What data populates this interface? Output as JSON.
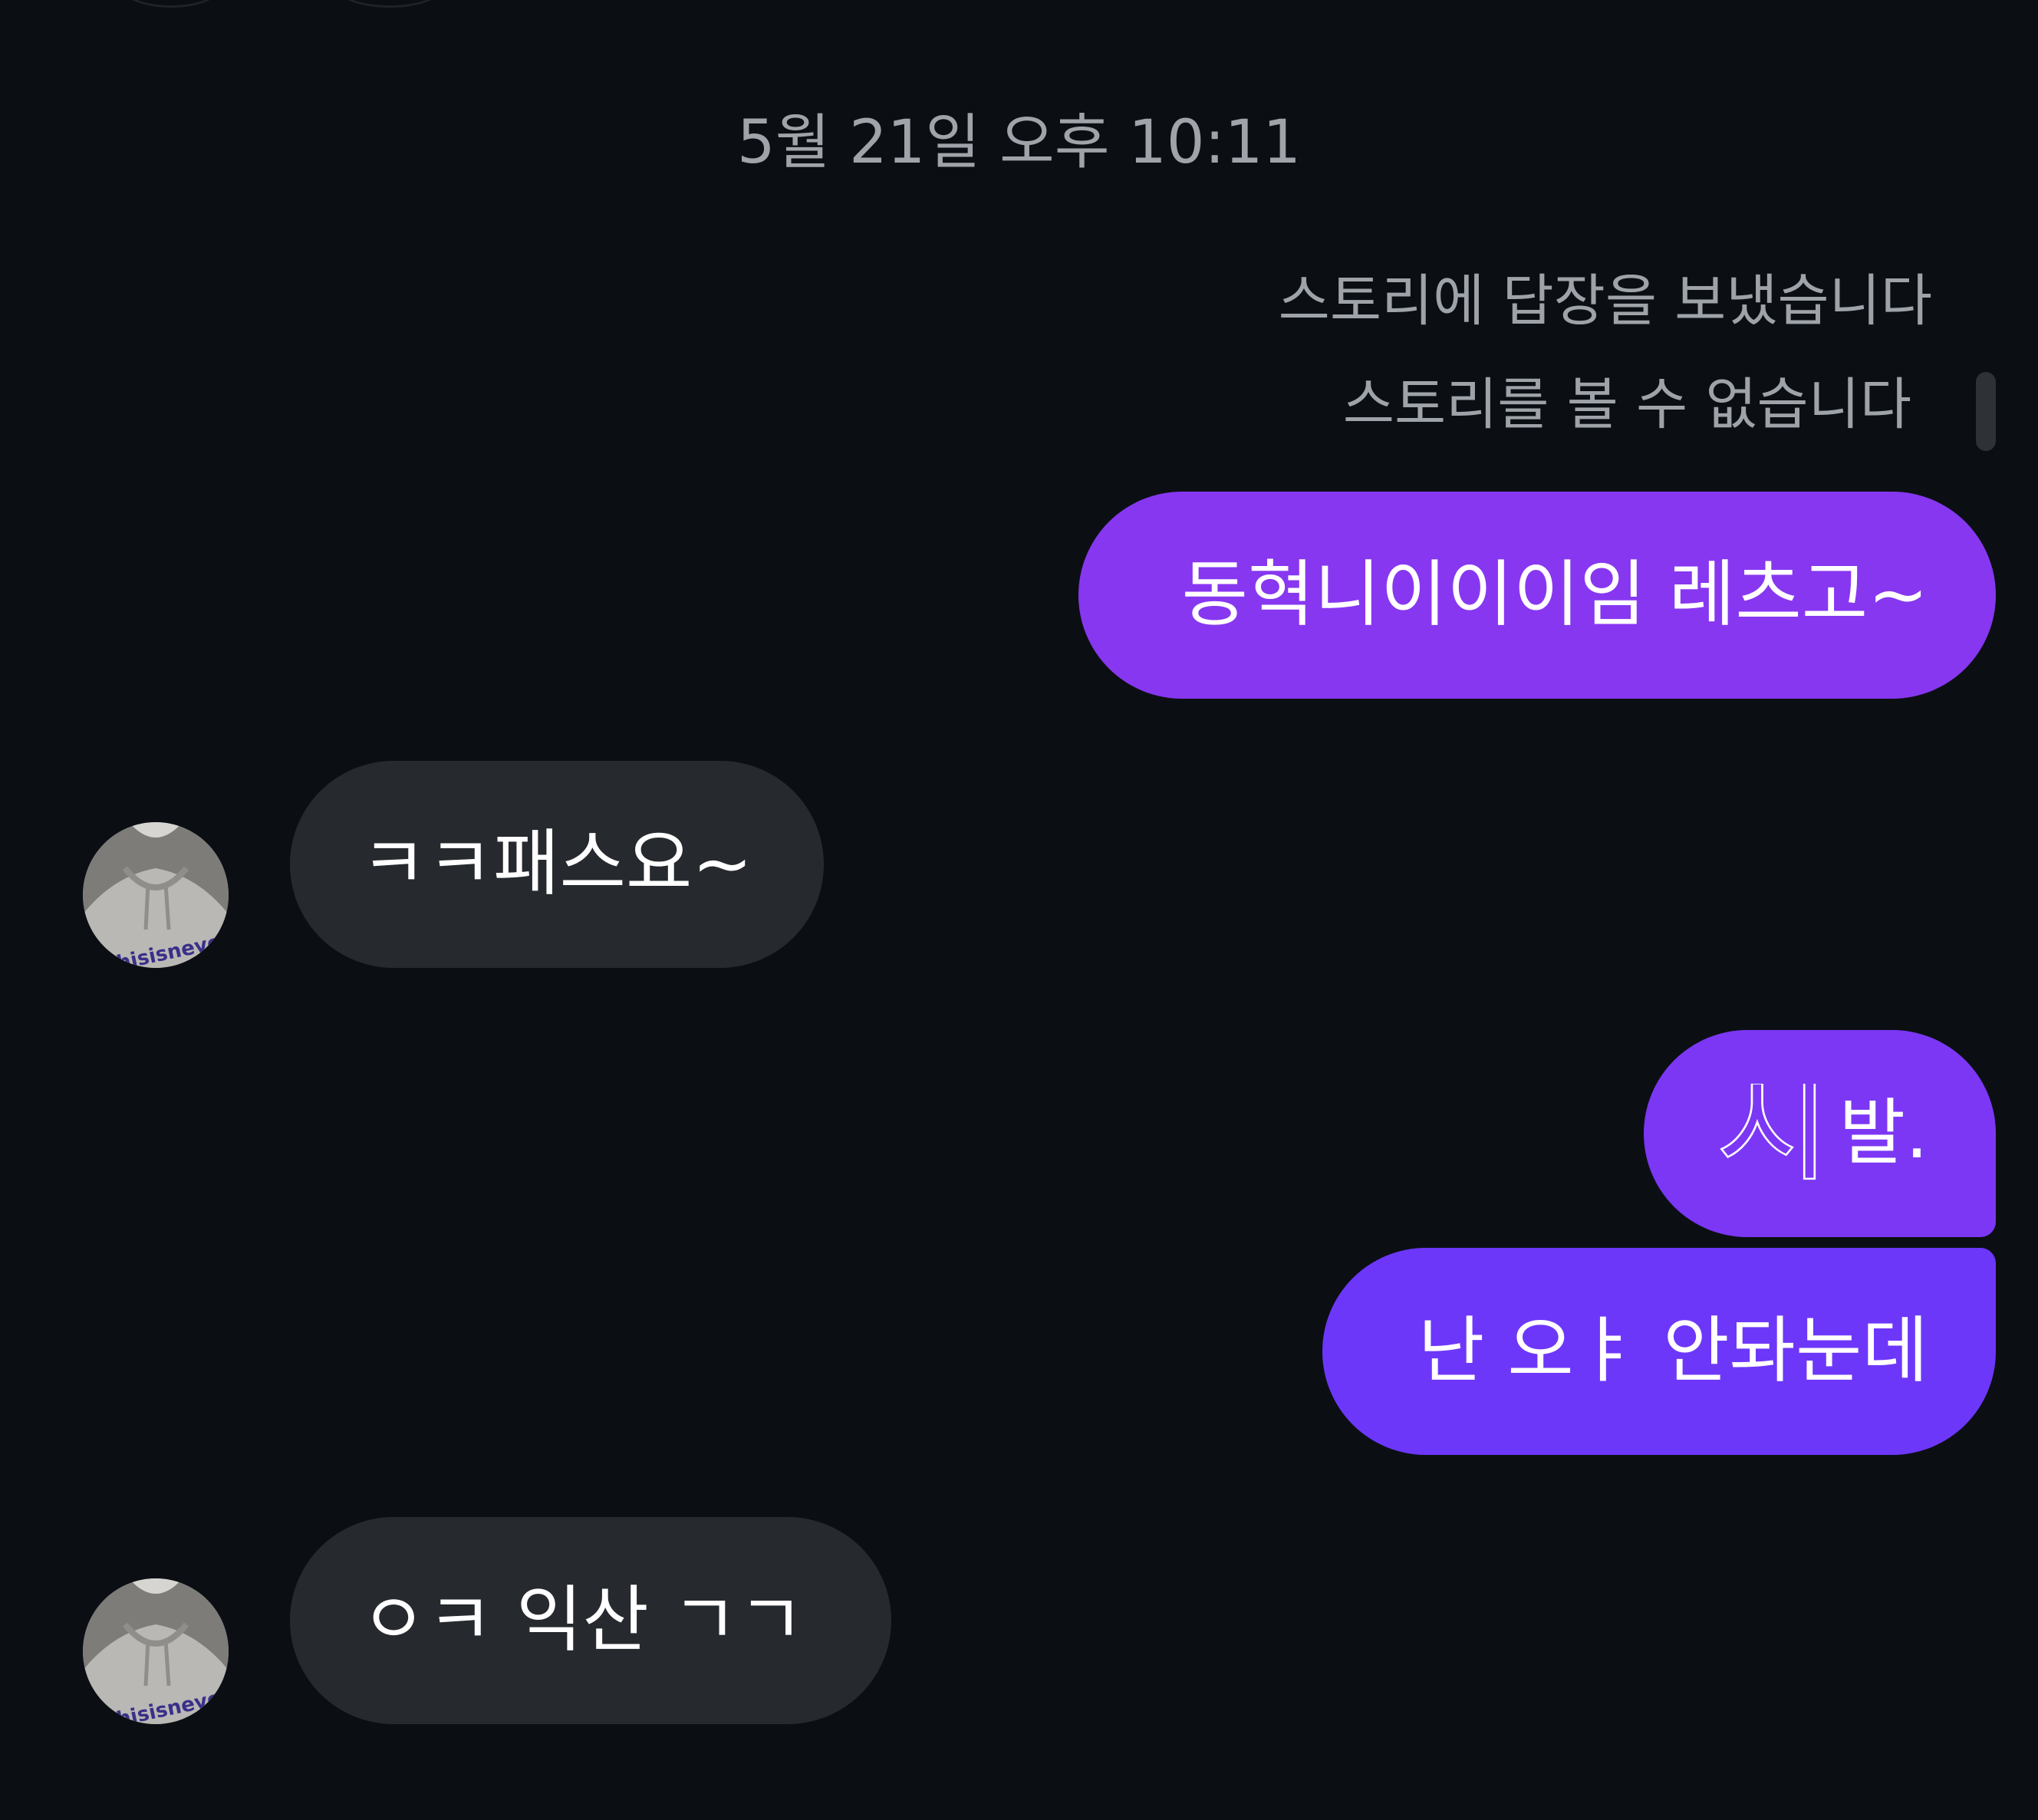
{
  "conversation": {
    "timestamp": "5월 21일 오후 10:11",
    "story_reply_note": "스토리에 답장을 보냈습니다",
    "story_unavailable_note": "스토리를 볼 수 없습니다",
    "messages": [
      {
        "sender": "me",
        "text": "동혁니이이이임 레츠고~"
      },
      {
        "sender": "them",
        "text": "ㅋㅋ패스요~"
      },
      {
        "sender": "me",
        "text": "발.",
        "stylized_glyph": "시"
      },
      {
        "sender": "me",
        "text": "난 오ㅑ 안돠눈데"
      },
      {
        "sender": "them",
        "text": "ㅇㅋ 익산 ㄱㄱ"
      }
    ],
    "avatar_shirt_text": "thisisneverthat"
  },
  "colors": {
    "background": "#0b0f14",
    "sent_bubble_top": "#8737f0",
    "sent_bubble_mid": "#7c37f5",
    "sent_bubble_bottom": "#6d37fa",
    "received_bubble": "#262a2e",
    "meta_text": "#a0a4aa"
  }
}
